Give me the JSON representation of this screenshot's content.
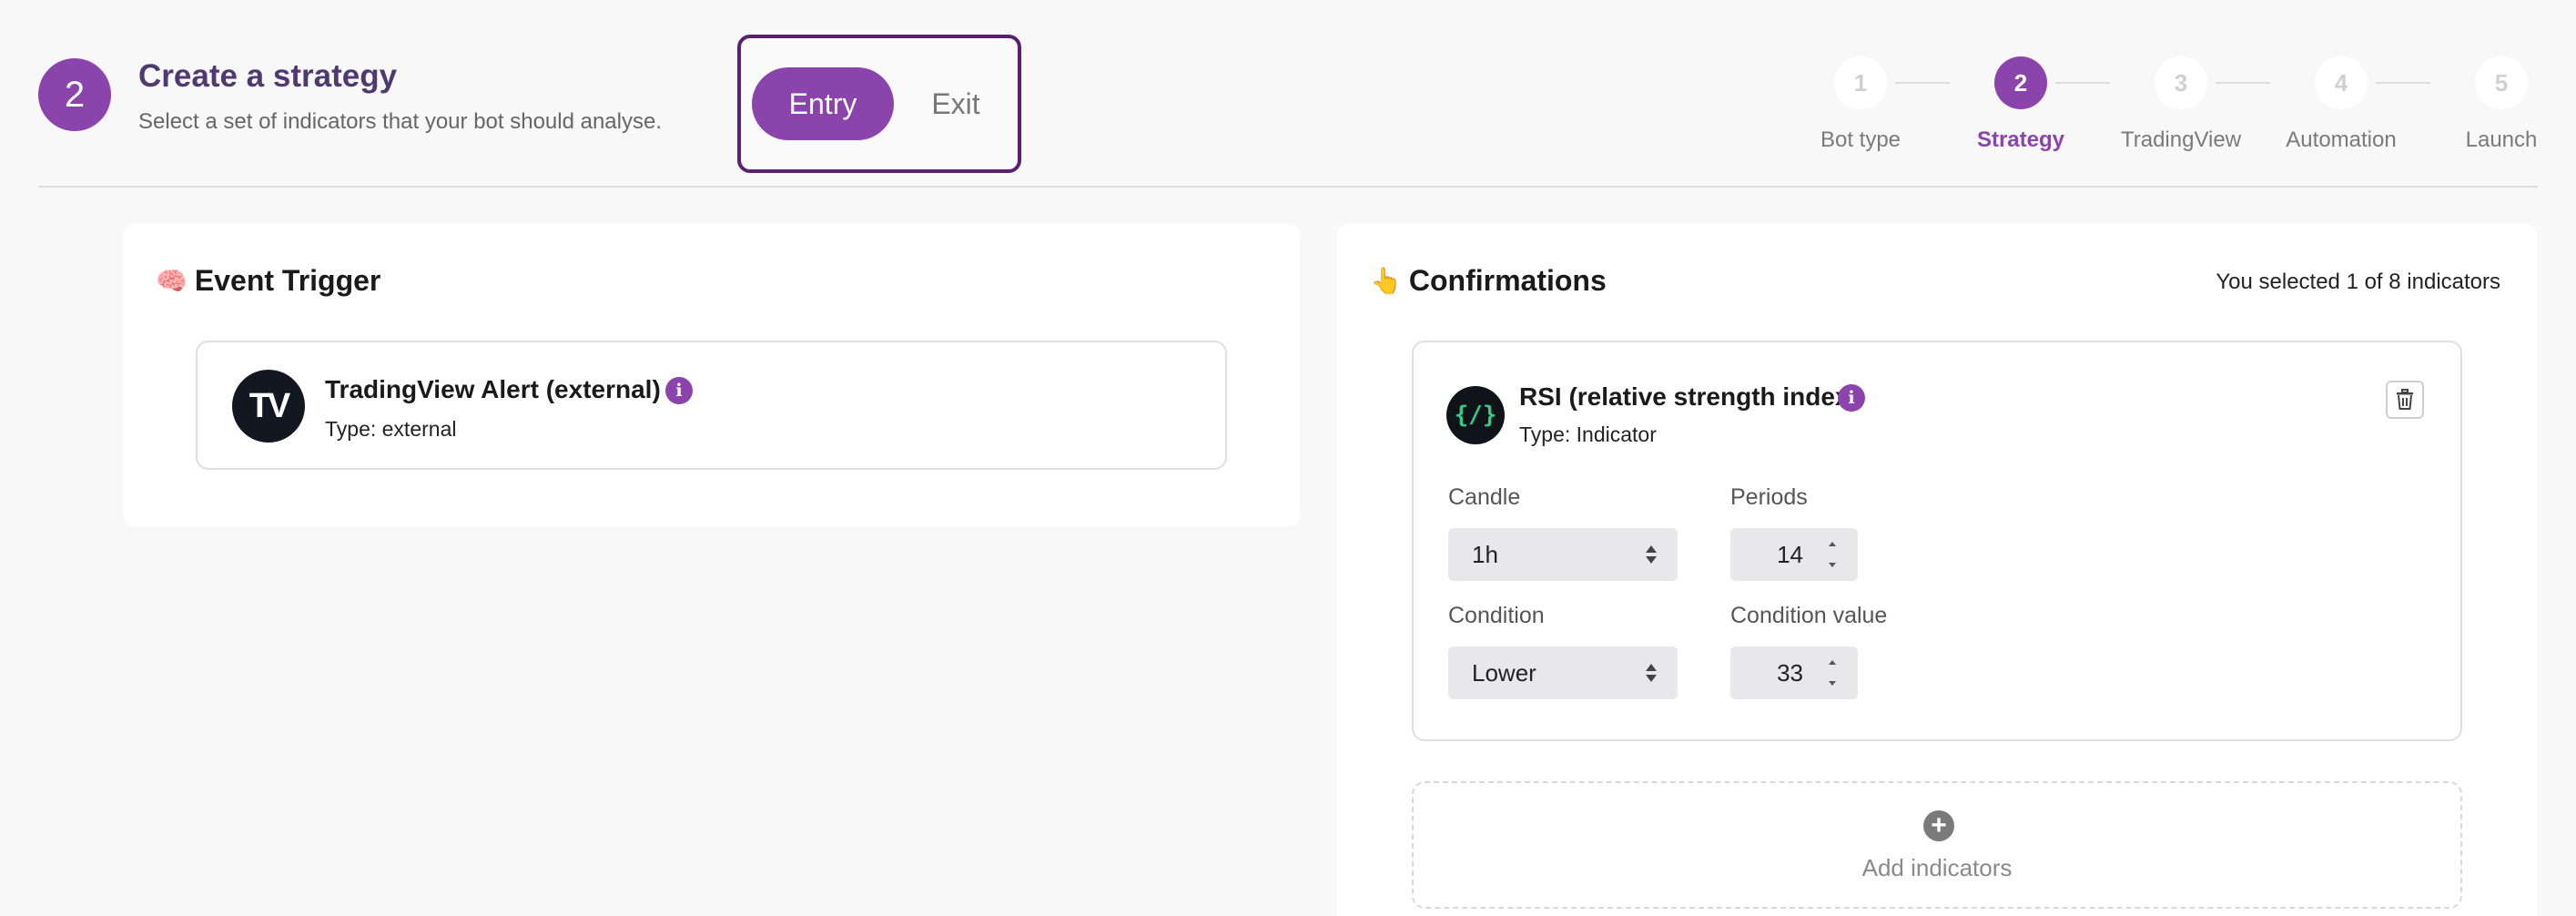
{
  "header": {
    "step_number": "2",
    "title": "Create a strategy",
    "subtitle": "Select a set of indicators that your bot should analyse."
  },
  "mode_toggle": {
    "entry_label": "Entry",
    "exit_label": "Exit",
    "selected": "Entry"
  },
  "stepper": {
    "steps": [
      {
        "number": "1",
        "label": "Bot type",
        "active": false
      },
      {
        "number": "2",
        "label": "Strategy",
        "active": true
      },
      {
        "number": "3",
        "label": "TradingView",
        "active": false
      },
      {
        "number": "4",
        "label": "Automation",
        "active": false
      },
      {
        "number": "5",
        "label": "Launch",
        "active": false
      }
    ]
  },
  "event_trigger": {
    "emoji": "🧠",
    "title": "Event Trigger",
    "item": {
      "logo_text": "TV",
      "name": "TradingView Alert (external)",
      "type": "Type: external",
      "info_icon": "info-icon"
    }
  },
  "confirmations": {
    "emoji": "👆",
    "title": "Confirmations",
    "summary": "You selected 1 of 8 indicators",
    "indicator": {
      "logo_text": "{/}",
      "name": "RSI (relative strength index)",
      "type": "Type: Indicator",
      "candle_label": "Candle",
      "candle_value": "1h",
      "periods_label": "Periods",
      "periods_value": "14",
      "condition_label": "Condition",
      "condition_value": "Lower",
      "condition_value_label": "Condition value",
      "condition_value_value": "33"
    },
    "add_label": "Add indicators"
  },
  "colors": {
    "accent": "#8b44ac",
    "title": "#4e3a71",
    "toggle_border": "#5a1f6e"
  }
}
